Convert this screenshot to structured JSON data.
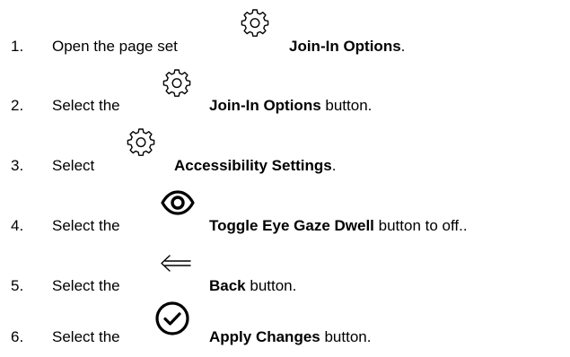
{
  "steps": [
    {
      "number": "1.",
      "before": "Open the page set",
      "icon": "gear-icon",
      "bold": "Join-In Options",
      "after": "."
    },
    {
      "number": "2.",
      "before": "Select the",
      "icon": "gear-icon",
      "bold": "Join-In Options",
      "after": " button."
    },
    {
      "number": "3.",
      "before": "Select",
      "icon": "gear-icon",
      "bold": "Accessibility Settings",
      "after": "."
    },
    {
      "number": "4.",
      "before": "Select the",
      "icon": "eye-icon",
      "bold": "Toggle Eye Gaze Dwell",
      "after": " button to off.."
    },
    {
      "number": "5.",
      "before": "Select the",
      "icon": "back-arrow-icon",
      "bold": "Back",
      "after": " button."
    },
    {
      "number": "6.",
      "before": "Select the",
      "icon": "check-circle-icon",
      "bold": "Apply Changes",
      "after": " button."
    }
  ]
}
